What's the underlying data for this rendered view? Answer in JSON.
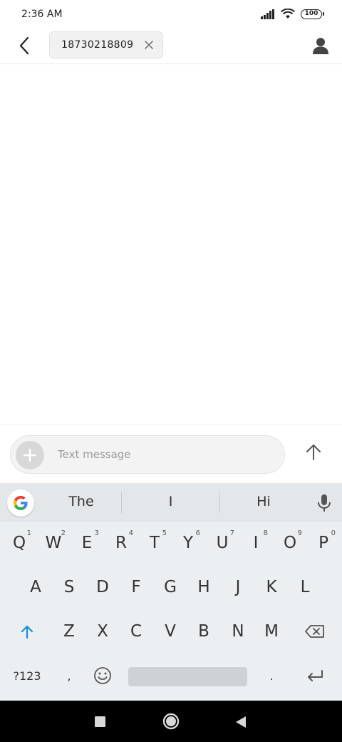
{
  "status_bar": {
    "time": "2:36 AM",
    "battery": "100"
  },
  "header": {
    "recipient": "18730218809"
  },
  "composer": {
    "placeholder": "Text message"
  },
  "keyboard": {
    "suggestions": [
      "The",
      "I",
      "Hi"
    ],
    "row1": [
      {
        "key": "Q",
        "hint": "1"
      },
      {
        "key": "W",
        "hint": "2"
      },
      {
        "key": "E",
        "hint": "3"
      },
      {
        "key": "R",
        "hint": "4"
      },
      {
        "key": "T",
        "hint": "5"
      },
      {
        "key": "Y",
        "hint": "6"
      },
      {
        "key": "U",
        "hint": "7"
      },
      {
        "key": "I",
        "hint": "8"
      },
      {
        "key": "O",
        "hint": "9"
      },
      {
        "key": "P",
        "hint": "0"
      }
    ],
    "row2": [
      "A",
      "S",
      "D",
      "F",
      "G",
      "H",
      "J",
      "K",
      "L"
    ],
    "row3": [
      "Z",
      "X",
      "C",
      "V",
      "B",
      "N",
      "M"
    ],
    "symbols_label": "?123",
    "comma": ",",
    "period": "."
  },
  "colors": {
    "shift_accent": "#1a8ee1",
    "keyboard_bg": "#eceff1"
  }
}
